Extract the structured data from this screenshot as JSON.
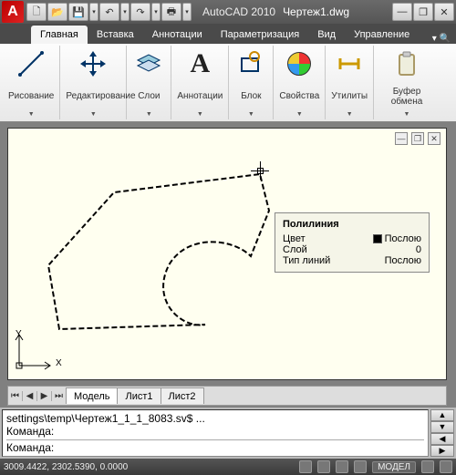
{
  "titlebar": {
    "app_name": "AutoCAD 2010",
    "file_name": "Чертеж1.dwg",
    "qat": {
      "new": "🗋",
      "open": "📂",
      "save": "💾",
      "undo": "↶",
      "redo": "↷",
      "print": "🖶"
    },
    "win": {
      "min": "—",
      "max": "❐",
      "close": "✕"
    }
  },
  "ribbon": {
    "tabs": [
      "Главная",
      "Вставка",
      "Аннотации",
      "Параметризация",
      "Вид",
      "Управление"
    ],
    "extra": "▾ 🔍",
    "panels": {
      "draw": {
        "label": "Рисование"
      },
      "edit": {
        "label": "Редактирование"
      },
      "layers": {
        "label": "Слои"
      },
      "annot": {
        "label": "Аннотации",
        "glyph": "A"
      },
      "block": {
        "label": "Блок"
      },
      "props": {
        "label": "Свойства"
      },
      "utils": {
        "label": "Утилиты"
      },
      "clip": {
        "label": "Буфер обмена"
      }
    }
  },
  "viewport_controls": {
    "min": "—",
    "max": "❐",
    "close": "✕"
  },
  "ucs": {
    "x": "X",
    "y": "Y"
  },
  "tooltip": {
    "title": "Полилиния",
    "rows": {
      "color": {
        "k": "Цвет",
        "v": "Послою"
      },
      "layer": {
        "k": "Слой",
        "v": "0"
      },
      "linetype": {
        "k": "Тип линий",
        "v": "Послою"
      }
    }
  },
  "layout_tabs": {
    "nav": [
      "⏮",
      "◀",
      "▶",
      "⏭"
    ],
    "tabs": [
      "Модель",
      "Лист1",
      "Лист2"
    ]
  },
  "command": {
    "hist1": "settings\\temp\\Чертеж1_1_1_8083.sv$ ...",
    "hist2": "Команда:",
    "prompt": "Команда:"
  },
  "status": {
    "coords": "3009.4422, 2302.5390, 0.0000",
    "mode": "МОДЕЛ"
  }
}
